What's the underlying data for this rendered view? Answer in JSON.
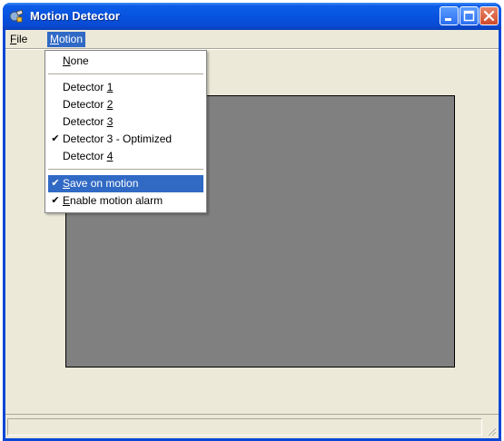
{
  "window": {
    "title": "Motion Detector",
    "app_icon": "motion-detector-app-icon",
    "controls": [
      "minimize-icon",
      "maximize-icon",
      "close-icon"
    ]
  },
  "menubar": {
    "file": {
      "label": "File",
      "mnemonic": "F",
      "rest": "ile"
    },
    "motion": {
      "label": "Motion",
      "mnemonic": "M",
      "rest": "otion"
    }
  },
  "motion_menu": {
    "none": {
      "pre": "",
      "key": "N",
      "post": "one",
      "checked": false
    },
    "detector1": {
      "pre": "Detector ",
      "key": "1",
      "post": "",
      "checked": false
    },
    "detector2": {
      "pre": "Detector ",
      "key": "2",
      "post": "",
      "checked": false
    },
    "detector3": {
      "pre": "Detector ",
      "key": "3",
      "post": "",
      "checked": false
    },
    "detector3opt": {
      "label": "Detector 3 - Optimized",
      "checked": true
    },
    "detector4": {
      "pre": "Detector ",
      "key": "4",
      "post": "",
      "checked": false
    },
    "save_on_motion": {
      "pre": "",
      "key": "S",
      "post": "ave on motion",
      "checked": true,
      "highlighted": true
    },
    "enable_alarm": {
      "pre": "",
      "key": "E",
      "post": "nable motion alarm",
      "checked": true
    }
  },
  "check_glyph": "✔",
  "colors": {
    "titlebar": "#0a53dc",
    "highlight": "#316ac5",
    "client": "#ece9d8",
    "video": "#808080"
  },
  "statusbar": {
    "text": ""
  }
}
